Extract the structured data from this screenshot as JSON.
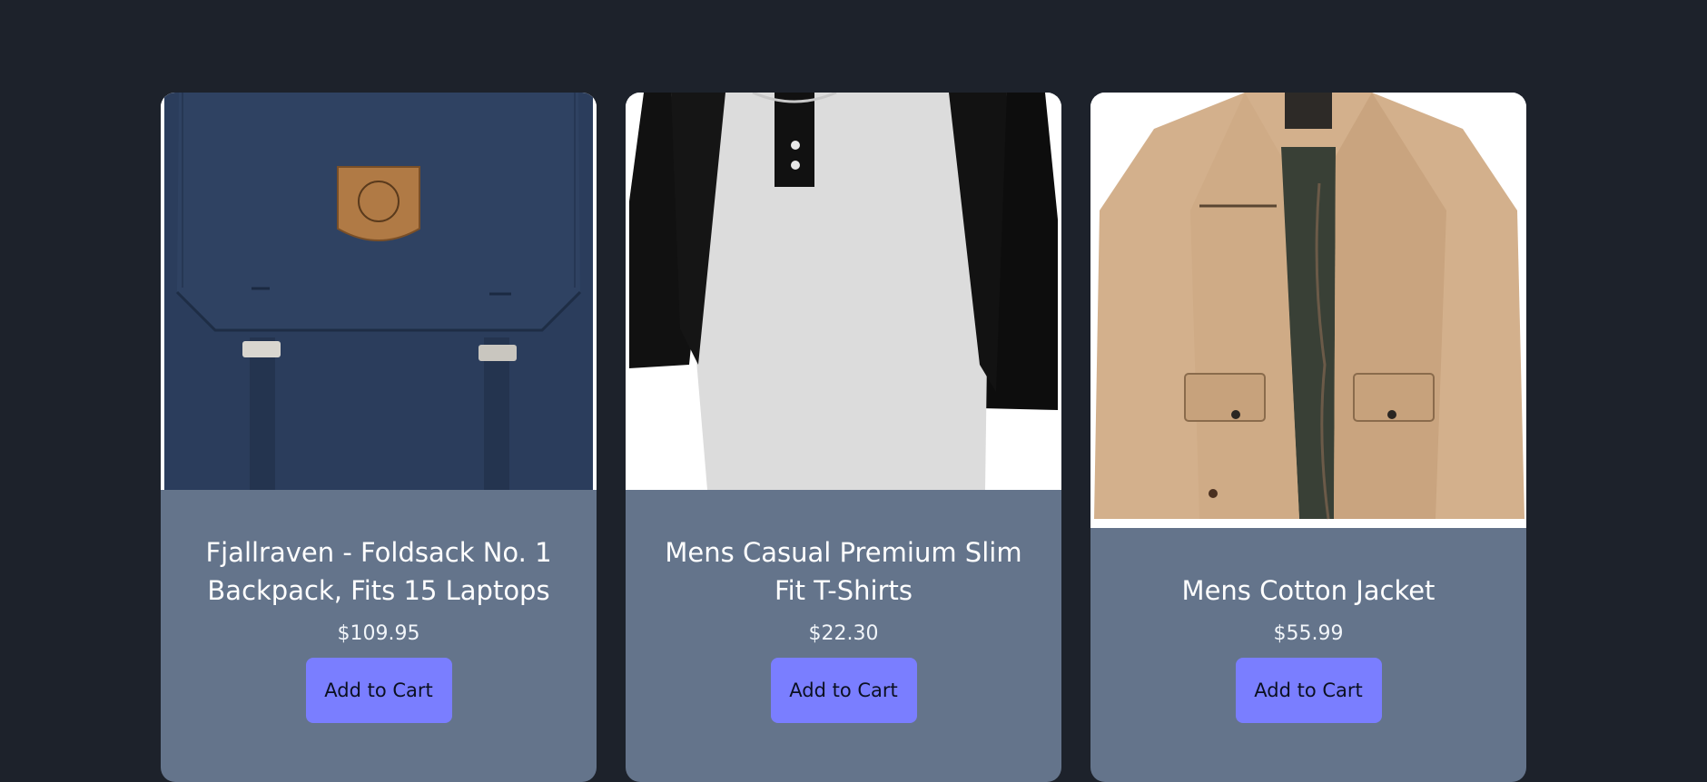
{
  "products": [
    {
      "title": "Fjallraven - Foldsack No. 1 Backpack, Fits 15 Laptops",
      "price": "$109.95",
      "button": "Add to Cart",
      "image": "backpack-image"
    },
    {
      "title": "Mens Casual Premium Slim Fit T-Shirts",
      "price": "$22.30",
      "button": "Add to Cart",
      "image": "tshirt-image"
    },
    {
      "title": "Mens Cotton Jacket",
      "price": "$55.99",
      "button": "Add to Cart",
      "image": "jacket-image"
    }
  ],
  "colors": {
    "page_background": "#1d222b",
    "card_background": "#64748b",
    "button_background": "#7a7eff"
  }
}
